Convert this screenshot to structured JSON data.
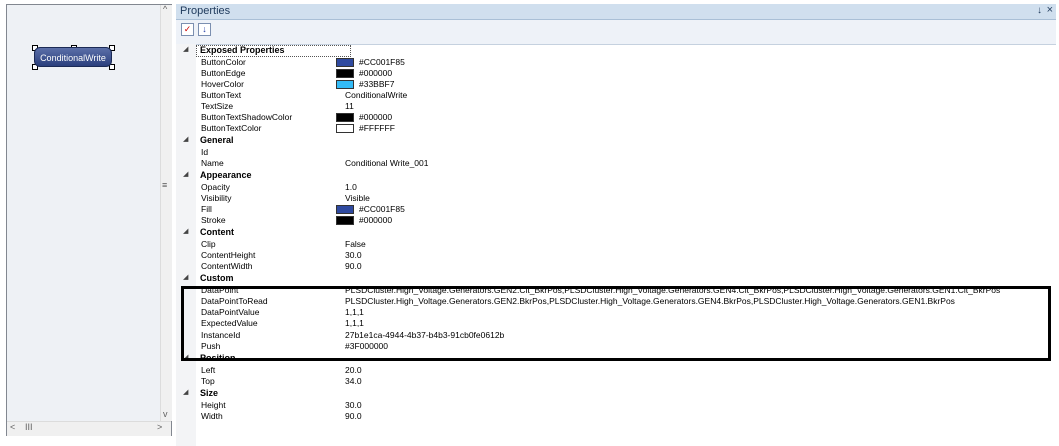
{
  "designer": {
    "button_text": "ConditionalWrite",
    "vscroll_up": "^",
    "vscroll_down": "v",
    "hscroll_left": "<",
    "hscroll_right": ">",
    "hscroll_thumb": "III",
    "grip": "≡"
  },
  "panel": {
    "title": "Properties",
    "pin": "↓",
    "close": "×"
  },
  "categories": {
    "exposed": "Exposed Properties",
    "general": "General",
    "appearance": "Appearance",
    "content": "Content",
    "custom": "Custom",
    "position": "Position",
    "size": "Size"
  },
  "exposed": {
    "ButtonColor": {
      "name": "ButtonColor",
      "value": "#CC001F85",
      "color": "#2f4aa0"
    },
    "ButtonEdge": {
      "name": "ButtonEdge",
      "value": "#000000",
      "color": "#000000"
    },
    "HoverColor": {
      "name": "HoverColor",
      "value": "#33BBF7",
      "color": "#33BBF7"
    },
    "ButtonText": {
      "name": "ButtonText",
      "value": "ConditionalWrite"
    },
    "TextSize": {
      "name": "TextSize",
      "value": "11"
    },
    "ButtonTextShadowColor": {
      "name": "ButtonTextShadowColor",
      "value": "#000000",
      "color": "#000000"
    },
    "ButtonTextColor": {
      "name": "ButtonTextColor",
      "value": "#FFFFFF",
      "color": "#FFFFFF"
    }
  },
  "general": {
    "Id": {
      "name": "Id",
      "value": ""
    },
    "Name": {
      "name": "Name",
      "value": "Conditional Write_001"
    }
  },
  "appearance": {
    "Opacity": {
      "name": "Opacity",
      "value": "1.0"
    },
    "Visibility": {
      "name": "Visibility",
      "value": "Visible"
    },
    "Fill": {
      "name": "Fill",
      "value": "#CC001F85",
      "color": "#2f4aa0"
    },
    "Stroke": {
      "name": "Stroke",
      "value": "#000000",
      "color": "#000000"
    }
  },
  "content": {
    "Clip": {
      "name": "Clip",
      "value": "False"
    },
    "ContentHeight": {
      "name": "ContentHeight",
      "value": "30.0"
    },
    "ContentWidth": {
      "name": "ContentWidth",
      "value": "90.0"
    }
  },
  "custom": {
    "DataPoint": {
      "name": "DataPoint",
      "value": "PLSDCluster.High_Voltage.Generators.GEN2.Clt_BkrPos,PLSDCluster.High_Voltage.Generators.GEN4.Clt_BkrPos,PLSDCluster.High_Voltage.Generators.GEN1.Clt_BkrPos"
    },
    "DataPointToRead": {
      "name": "DataPointToRead",
      "value": "PLSDCluster.High_Voltage.Generators.GEN2.BkrPos,PLSDCluster.High_Voltage.Generators.GEN4.BkrPos,PLSDCluster.High_Voltage.Generators.GEN1.BkrPos"
    },
    "DataPointValue": {
      "name": "DataPointValue",
      "value": "1,1,1"
    },
    "ExpectedValue": {
      "name": "ExpectedValue",
      "value": "1,1,1"
    },
    "InstanceId": {
      "name": "InstanceId",
      "value": "27b1e1ca-4944-4b37-b4b3-91cb0fe0612b"
    },
    "Push": {
      "name": "Push",
      "value": "#3F000000"
    }
  },
  "position": {
    "Left": {
      "name": "Left",
      "value": "20.0"
    },
    "Top": {
      "name": "Top",
      "value": "34.0"
    }
  },
  "size": {
    "Height": {
      "name": "Height",
      "value": "30.0"
    },
    "Width": {
      "name": "Width",
      "value": "90.0"
    }
  }
}
